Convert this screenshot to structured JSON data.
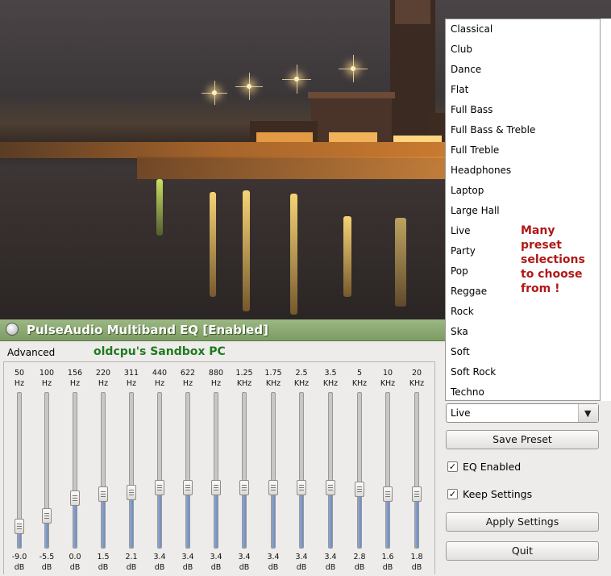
{
  "window": {
    "title": "PulseAudio Multiband EQ [Enabled]",
    "advanced_label": "Advanced",
    "machine_label": "oldcpu's Sandbox PC"
  },
  "bands": [
    {
      "freq": "50",
      "unit": "Hz",
      "gain": "-9.0",
      "db": "dB",
      "level": 0.14
    },
    {
      "freq": "100",
      "unit": "Hz",
      "gain": "-5.5",
      "db": "dB",
      "level": 0.21
    },
    {
      "freq": "156",
      "unit": "Hz",
      "gain": "0.0",
      "db": "dB",
      "level": 0.32
    },
    {
      "freq": "220",
      "unit": "Hz",
      "gain": "1.5",
      "db": "dB",
      "level": 0.35
    },
    {
      "freq": "311",
      "unit": "Hz",
      "gain": "2.1",
      "db": "dB",
      "level": 0.36
    },
    {
      "freq": "440",
      "unit": "Hz",
      "gain": "3.4",
      "db": "dB",
      "level": 0.39
    },
    {
      "freq": "622",
      "unit": "Hz",
      "gain": "3.4",
      "db": "dB",
      "level": 0.39
    },
    {
      "freq": "880",
      "unit": "Hz",
      "gain": "3.4",
      "db": "dB",
      "level": 0.39
    },
    {
      "freq": "1.25",
      "unit": "KHz",
      "gain": "3.4",
      "db": "dB",
      "level": 0.39
    },
    {
      "freq": "1.75",
      "unit": "KHz",
      "gain": "3.4",
      "db": "dB",
      "level": 0.39
    },
    {
      "freq": "2.5",
      "unit": "KHz",
      "gain": "3.4",
      "db": "dB",
      "level": 0.39
    },
    {
      "freq": "3.5",
      "unit": "KHz",
      "gain": "3.4",
      "db": "dB",
      "level": 0.39
    },
    {
      "freq": "5",
      "unit": "KHz",
      "gain": "2.8",
      "db": "dB",
      "level": 0.38
    },
    {
      "freq": "10",
      "unit": "KHz",
      "gain": "1.6",
      "db": "dB",
      "level": 0.35
    },
    {
      "freq": "20",
      "unit": "KHz",
      "gain": "1.8",
      "db": "dB",
      "level": 0.35
    }
  ],
  "preset": {
    "selected": "Live",
    "options": [
      "Classical",
      "Club",
      "Dance",
      "Flat",
      "Full Bass",
      "Full Bass & Treble",
      "Full Treble",
      "Headphones",
      "Laptop",
      "Large Hall",
      "Live",
      "Party",
      "Pop",
      "Reggae",
      "Rock",
      "Ska",
      "Soft",
      "Soft Rock",
      "Techno"
    ]
  },
  "controls": {
    "save_preset": "Save Preset",
    "eq_enabled": "EQ Enabled",
    "eq_enabled_checked": true,
    "keep_settings": "Keep Settings",
    "keep_settings_checked": true,
    "apply_settings": "Apply Settings",
    "quit": "Quit",
    "check_mark": "✓"
  },
  "annotation": [
    "Many",
    "preset",
    "selections",
    "to choose",
    "from !"
  ],
  "icons": {
    "app": "pulseaudio-app-icon",
    "combo": "chevron-down-icon",
    "check": "check-icon"
  },
  "colors": {
    "titlebar": "#8aa972",
    "slider_fill": "#7b96c6",
    "annotation": "#b01818",
    "machine_label": "#1f7a1f"
  }
}
